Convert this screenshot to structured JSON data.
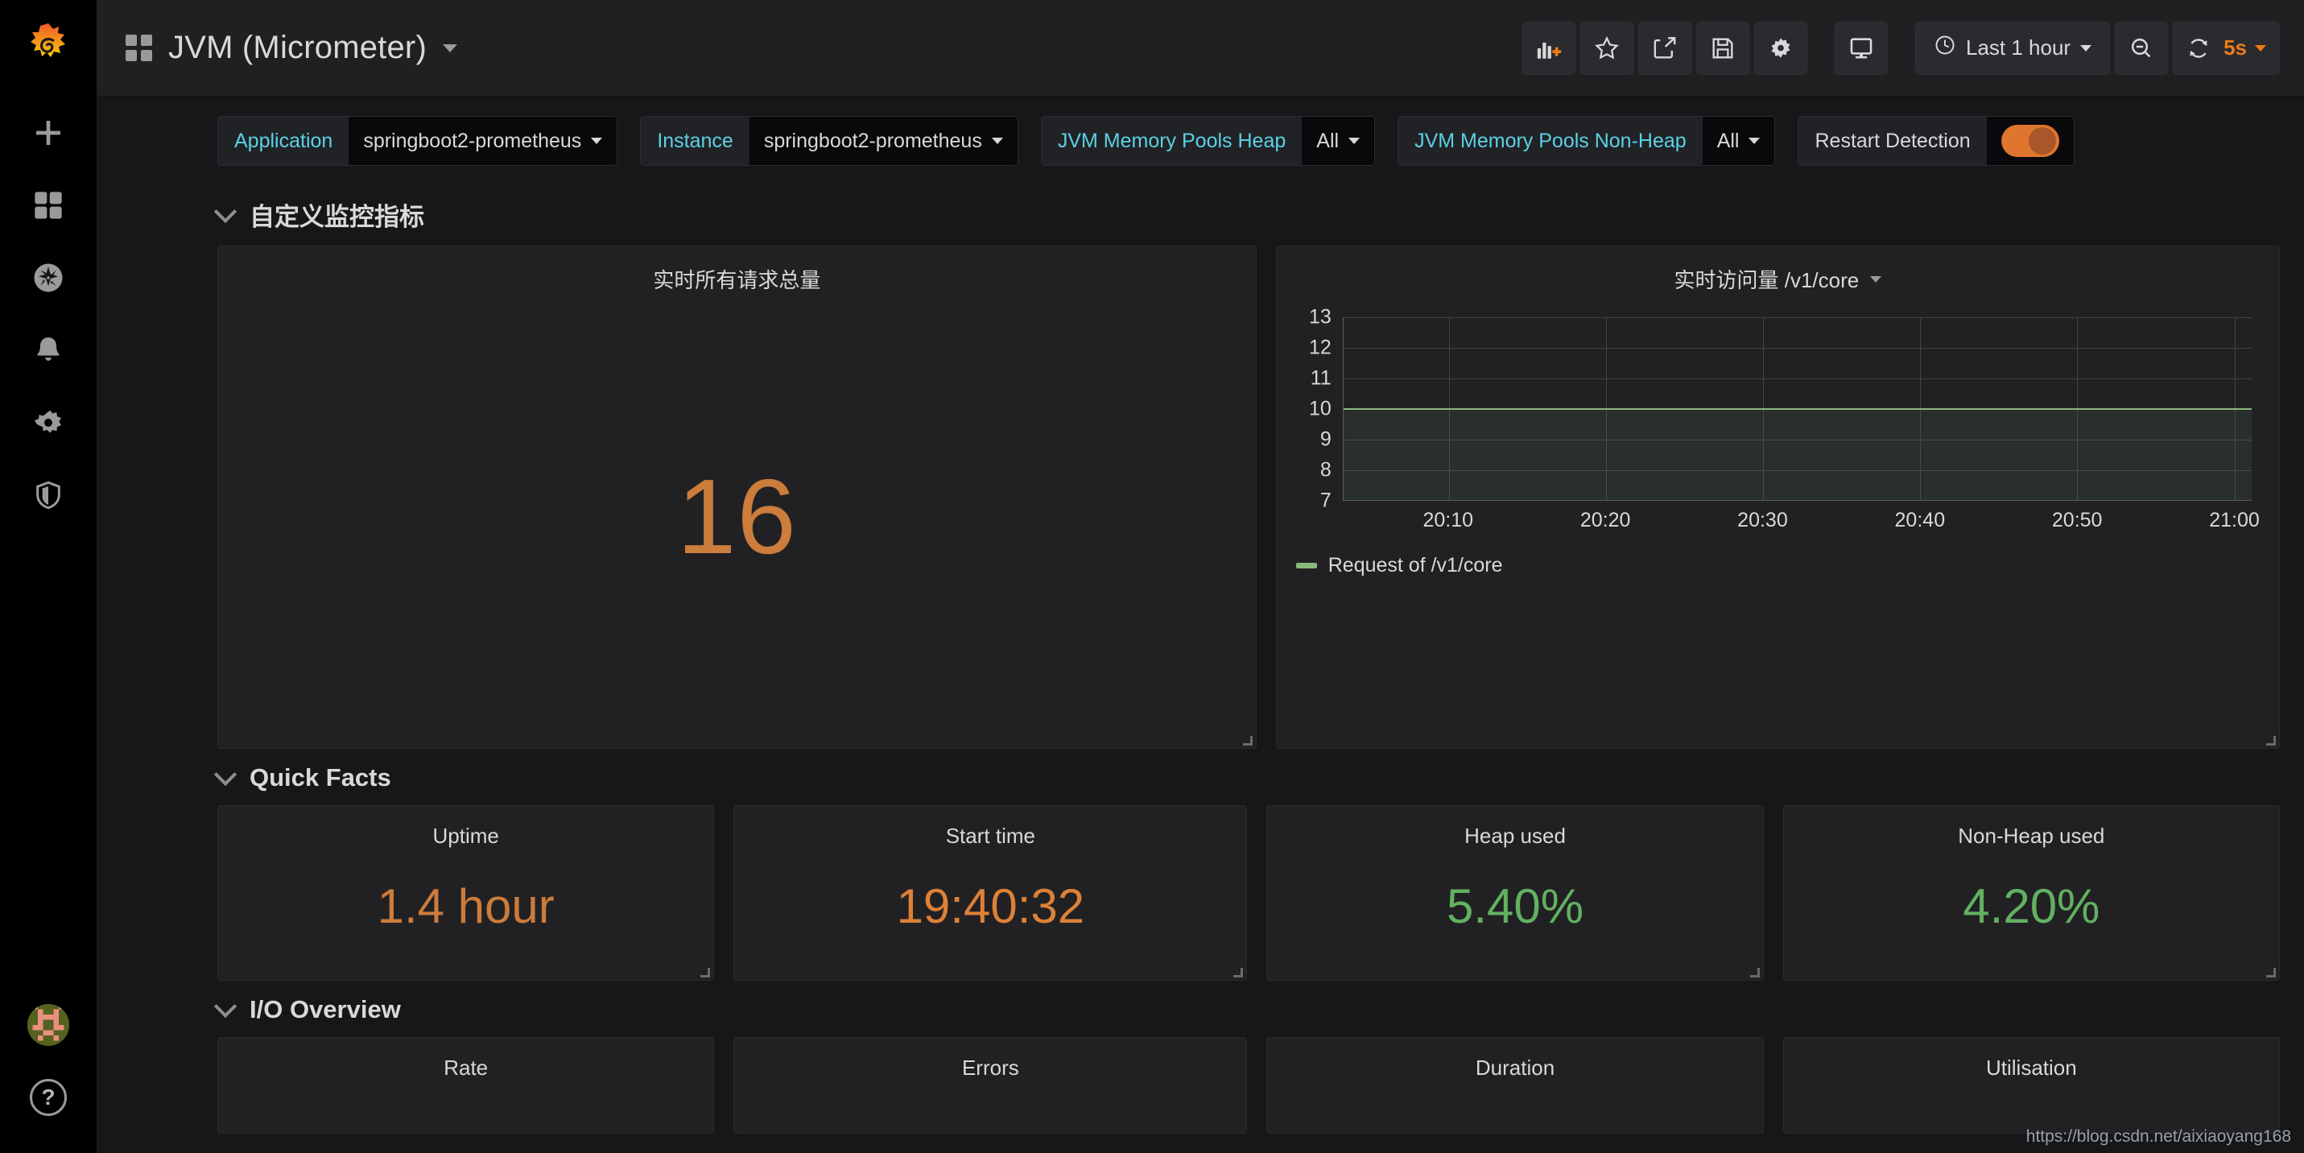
{
  "sidebar": {
    "logo_icon": "grafana-logo-icon",
    "items": [
      {
        "icon": "plus-icon",
        "name": "create"
      },
      {
        "icon": "dashboards-icon",
        "name": "dashboards"
      },
      {
        "icon": "compass-icon",
        "name": "explore"
      },
      {
        "icon": "bell-icon",
        "name": "alerting"
      },
      {
        "icon": "gear-icon",
        "name": "configuration"
      },
      {
        "icon": "shield-icon",
        "name": "server-admin"
      }
    ],
    "bottom": [
      {
        "icon": "avatar-icon",
        "name": "user-profile"
      },
      {
        "icon": "help-icon",
        "name": "help",
        "glyph": "?"
      }
    ]
  },
  "topnav": {
    "dashboard_icon": "dashboard-grid-icon",
    "title": "JVM (Micrometer)",
    "title_caret_icon": "chevron-down-icon",
    "tools": [
      {
        "name": "add-panel-button",
        "icon": "add-panel-icon"
      },
      {
        "name": "mark-favorite-button",
        "icon": "star-icon"
      },
      {
        "name": "share-dashboard-button",
        "icon": "share-icon"
      },
      {
        "name": "save-dashboard-button",
        "icon": "save-icon"
      },
      {
        "name": "dashboard-settings-button",
        "icon": "gear-icon"
      },
      {
        "name": "tv-mode-button",
        "icon": "monitor-icon"
      }
    ],
    "time_picker": {
      "icon": "clock-icon",
      "label": "Last 1 hour",
      "caret_icon": "chevron-down-icon"
    },
    "zoom_out": {
      "name": "zoom-out-button",
      "icon": "search-minus-icon"
    },
    "refresh": {
      "icon": "refresh-icon",
      "interval": "5s",
      "caret_icon": "chevron-down-icon"
    }
  },
  "variables": [
    {
      "label": "Application",
      "value": "springboot2-prometheus",
      "type": "select"
    },
    {
      "label": "Instance",
      "value": "springboot2-prometheus",
      "type": "select"
    },
    {
      "label": "JVM Memory Pools Heap",
      "value": "All",
      "type": "select"
    },
    {
      "label": "JVM Memory Pools Non-Heap",
      "value": "All",
      "type": "select"
    },
    {
      "label": "Restart Detection",
      "value": "on",
      "type": "toggle"
    }
  ],
  "sections": [
    {
      "title": "自定义监控指标",
      "collapse_icon": "chevron-down-icon"
    },
    {
      "title": "Quick Facts",
      "collapse_icon": "chevron-down-icon"
    },
    {
      "title": "I/O Overview",
      "collapse_icon": "chevron-down-icon"
    }
  ],
  "panels": {
    "requests_total": {
      "title": "实时所有请求总量",
      "value": "16",
      "color": "#cc7c3b"
    },
    "realtime_visits": {
      "title": "实时访问量 /v1/core",
      "caret_icon": "chevron-down-icon"
    },
    "quick_facts": [
      {
        "title": "Uptime",
        "value": "1.4 hour",
        "color": "#cc7c3b"
      },
      {
        "title": "Start time",
        "value": "19:40:32",
        "color": "#dd8136"
      },
      {
        "title": "Heap used",
        "value": "5.40%",
        "color": "#62b160"
      },
      {
        "title": "Non-Heap used",
        "value": "4.20%",
        "color": "#62b160"
      }
    ],
    "io_overview": [
      {
        "title": "Rate"
      },
      {
        "title": "Errors"
      },
      {
        "title": "Duration"
      },
      {
        "title": "Utilisation"
      }
    ]
  },
  "chart_data": {
    "type": "line",
    "title": "实时访问量 /v1/core",
    "xlabel": "",
    "ylabel": "",
    "ylim": [
      7,
      13
    ],
    "yticks": [
      7,
      8,
      9,
      10,
      11,
      12,
      13
    ],
    "xticks": [
      "20:10",
      "20:20",
      "20:30",
      "20:40",
      "20:50",
      "21:00"
    ],
    "xlim": [
      "20:05",
      "21:05"
    ],
    "grid": true,
    "legend_position": "bottom-left",
    "series": [
      {
        "name": "Request of /v1/core",
        "color": "#8ab87d",
        "fill": true,
        "x": [
          "20:05",
          "20:10",
          "20:20",
          "20:30",
          "20:40",
          "20:50",
          "21:00",
          "21:05"
        ],
        "values": [
          10,
          10,
          10,
          10,
          10,
          10,
          10,
          10
        ]
      }
    ]
  },
  "watermark": "https://blog.csdn.net/aixiaoyang168"
}
